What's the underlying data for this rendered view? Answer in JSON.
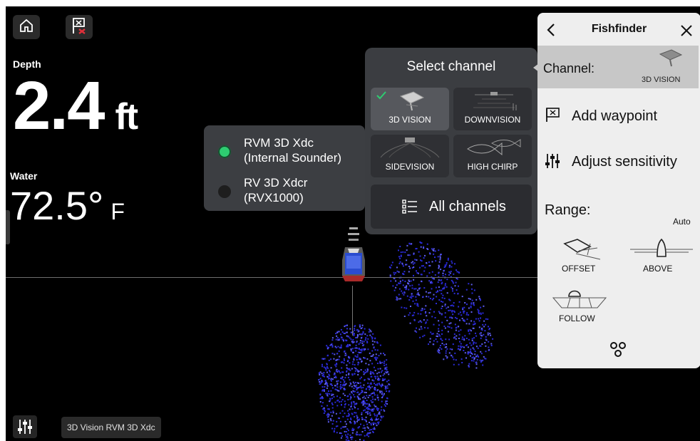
{
  "topbar": {
    "home_icon": "home-icon",
    "waypoint_icon": "waypoint-flag-icon"
  },
  "depth": {
    "label": "Depth",
    "value": "2.4",
    "unit": "ft"
  },
  "water": {
    "label": "Water",
    "value": "72.5°",
    "unit": "F"
  },
  "sounders": [
    {
      "label_line1": "RVM 3D Xdc",
      "label_line2": "(Internal Sounder)",
      "selected": true,
      "color": "#2ecc71"
    },
    {
      "label_line1": "RV 3D Xdcr",
      "label_line2": "(RVX1000)",
      "selected": false,
      "color": "#1e1e1e"
    }
  ],
  "channel_popup": {
    "title": "Select channel",
    "channels": [
      {
        "label": "3D VISION",
        "selected": true
      },
      {
        "label": "DOWNVISION",
        "selected": false
      },
      {
        "label": "SIDEVISION",
        "selected": false
      },
      {
        "label": "HIGH CHIRP",
        "selected": false
      }
    ],
    "all_channels_label": "All channels"
  },
  "side_panel": {
    "title": "Fishfinder",
    "channel_label": "Channel:",
    "channel_value": "3D VISION",
    "add_waypoint": "Add waypoint",
    "adjust_sensitivity": "Adjust sensitivity",
    "range_label": "Range:",
    "range_value": "Auto",
    "views": {
      "offset": "OFFSET",
      "above": "ABOVE",
      "follow": "FOLLOW"
    }
  },
  "status_bar": {
    "label": "3D Vision RVM 3D Xdc"
  },
  "colors": {
    "accent_green": "#2ecc71",
    "sonar_blue": "#2a2ad8",
    "panel_dark": "#3b3d41",
    "side_panel": "#eeeeee"
  }
}
